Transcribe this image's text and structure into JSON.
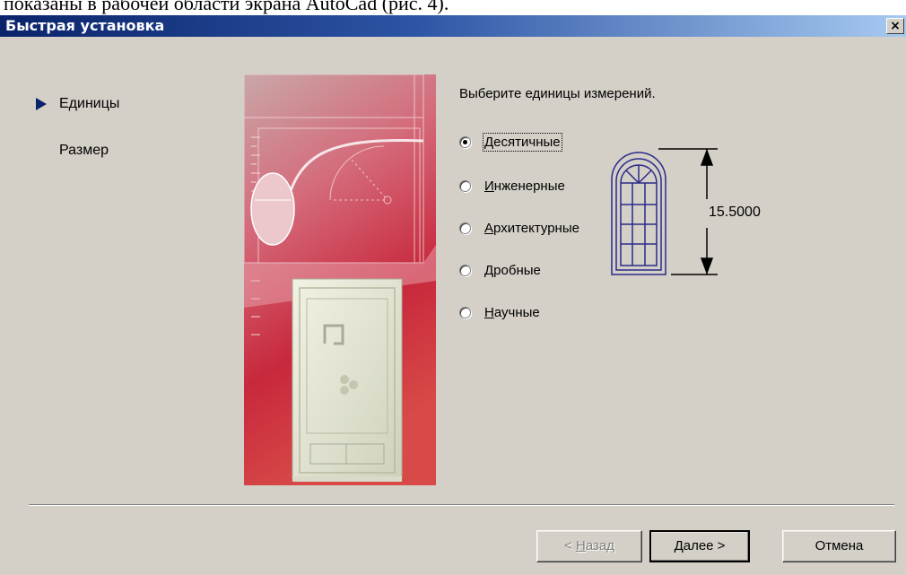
{
  "document_fragment": "показаны в рабочей области экрана AutoCad (рис. 4).",
  "window": {
    "title": "Быстрая установка",
    "close_label": "×"
  },
  "steps": [
    {
      "label": "Единицы",
      "active": true
    },
    {
      "label": "Размер",
      "active": false
    }
  ],
  "units": {
    "prompt": "Выберите единицы измерений.",
    "options": [
      {
        "mnemonic": "Д",
        "rest": "есятичные",
        "selected": true
      },
      {
        "mnemonic": "И",
        "rest": "нженерные",
        "selected": false
      },
      {
        "mnemonic": "А",
        "rest": "рхитектурные",
        "selected": false
      },
      {
        "mnemonic": "Д",
        "rest": "робные",
        "selected": false
      },
      {
        "mnemonic": "Н",
        "rest": "аучные",
        "selected": false
      }
    ],
    "sample_dimension": "15.5000"
  },
  "buttons": {
    "back": {
      "prefix": "< ",
      "mnemonic": "Н",
      "rest": "азад",
      "enabled": false
    },
    "next": {
      "label": "Далее >"
    },
    "cancel": {
      "label": "Отмена"
    }
  },
  "colors": {
    "title_start": "#0a246a",
    "title_end": "#a6caf0",
    "dialog_bg": "#d4d0c8",
    "art_red": "#c8283c"
  }
}
